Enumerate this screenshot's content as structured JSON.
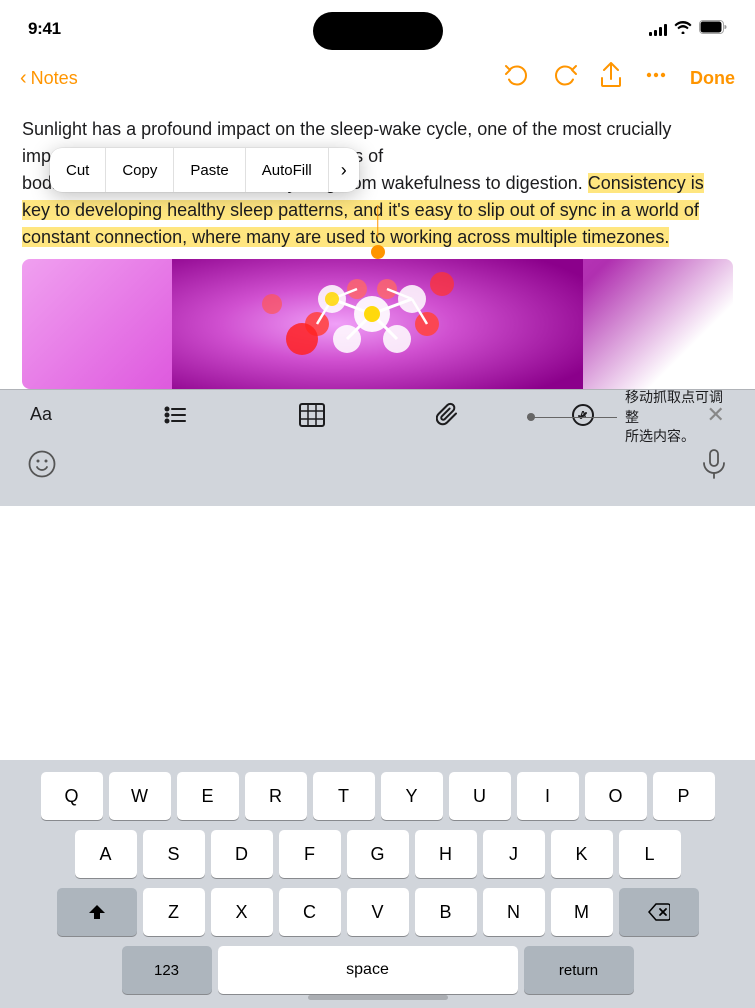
{
  "statusBar": {
    "time": "9:41",
    "signal": [
      3,
      5,
      7,
      9,
      11
    ],
    "wifi": "wifi",
    "battery": "battery"
  },
  "toolbar": {
    "backLabel": "Notes",
    "doneLabel": "Done"
  },
  "noteContent": {
    "paragraph1": "Sunlight has a profound impact on the sleep-wake cycle, one of the most crucially important of our circadian rhythms-a series of",
    "paragraph2": "bodies' functions to u, timize everything from wakefulness to digestion.",
    "highlighted": "Consistency is key to developing healthy sleep patterns, and it's easy to slip out of sync in a world of constant connection, where many are used to working across multiple timezones.",
    "calloutText": "移动抓取点可调整\n所选内容。"
  },
  "contextMenu": {
    "items": [
      "Cut",
      "Copy",
      "Paste",
      "AutoFill",
      "›"
    ]
  },
  "formatToolbar": {
    "aaLabel": "Aa",
    "listIcon": "list",
    "tableIcon": "table",
    "attachIcon": "attach",
    "penIcon": "pen",
    "closeIcon": "close"
  },
  "keyboard": {
    "row1": [
      "Q",
      "W",
      "E",
      "R",
      "T",
      "Y",
      "U",
      "I",
      "O",
      "P"
    ],
    "row2": [
      "A",
      "S",
      "D",
      "F",
      "G",
      "H",
      "J",
      "K",
      "L"
    ],
    "row3": [
      "Z",
      "X",
      "C",
      "V",
      "B",
      "N",
      "M"
    ],
    "numberLabel": "123",
    "spaceLabel": "space",
    "returnLabel": "return"
  }
}
